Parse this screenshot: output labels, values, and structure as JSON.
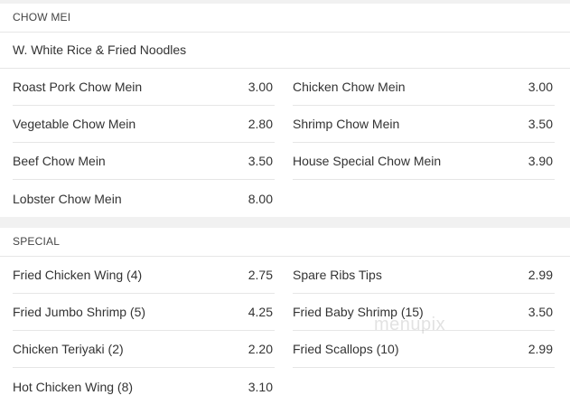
{
  "sections": [
    {
      "header": "CHOW MEI",
      "description": "W. White Rice & Fried Noodles",
      "left": [
        {
          "name": "Roast Pork Chow Mein",
          "price": "3.00"
        },
        {
          "name": "Vegetable Chow Mein",
          "price": "2.80"
        },
        {
          "name": "Beef Chow Mein",
          "price": "3.50"
        },
        {
          "name": "Lobster Chow Mein",
          "price": "8.00"
        }
      ],
      "right": [
        {
          "name": "Chicken Chow Mein",
          "price": "3.00"
        },
        {
          "name": "Shrimp Chow Mein",
          "price": "3.50"
        },
        {
          "name": "House Special Chow Mein",
          "price": "3.90"
        }
      ]
    },
    {
      "header": "SPECIAL",
      "left": [
        {
          "name": "Fried Chicken Wing (4)",
          "price": "2.75"
        },
        {
          "name": "Fried Jumbo Shrimp (5)",
          "price": "4.25"
        },
        {
          "name": "Chicken Teriyaki (2)",
          "price": "2.20"
        },
        {
          "name": "Hot Chicken Wing (8)",
          "price": "3.10"
        }
      ],
      "right": [
        {
          "name": "Spare Ribs Tips",
          "price": "2.99"
        },
        {
          "name": "Fried Baby Shrimp (15)",
          "price": "3.50"
        },
        {
          "name": "Fried Scallops (10)",
          "price": "2.99"
        }
      ]
    }
  ],
  "watermark": "menupix",
  "colors": {
    "background": "#f1f1f1",
    "card": "#ffffff",
    "divider": "#e6e6e6",
    "text": "#333333"
  }
}
